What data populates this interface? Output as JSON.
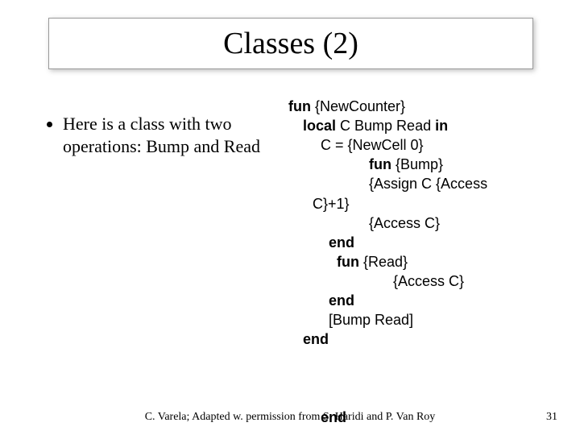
{
  "title": "Classes (2)",
  "bullet": "Here is a class with two operations: Bump and Read",
  "code": {
    "l1_kw": "fun",
    "l1_rest": " {NewCounter}",
    "l2_kw": "local",
    "l2_mid": " C Bump Read ",
    "l2_kw2": "in",
    "l3": "C = {NewCell 0}",
    "l4_kw": "fun",
    "l4_rest": " {Bump}",
    "l5": "{Assign C {Access",
    "l6": "C}+1}",
    "l7": "{Access C}",
    "l8_kw": "end",
    "l9_kw": "fun",
    "l9_rest": " {Read}",
    "l10": "{Access C}",
    "l11_kw": "end",
    "l12": "[Bump Read]",
    "l13_kw": "end",
    "l14_kw": "end"
  },
  "footer": {
    "credit": "C. Varela;  Adapted w. permission from S. Haridi and P. Van Roy",
    "page": "31"
  }
}
